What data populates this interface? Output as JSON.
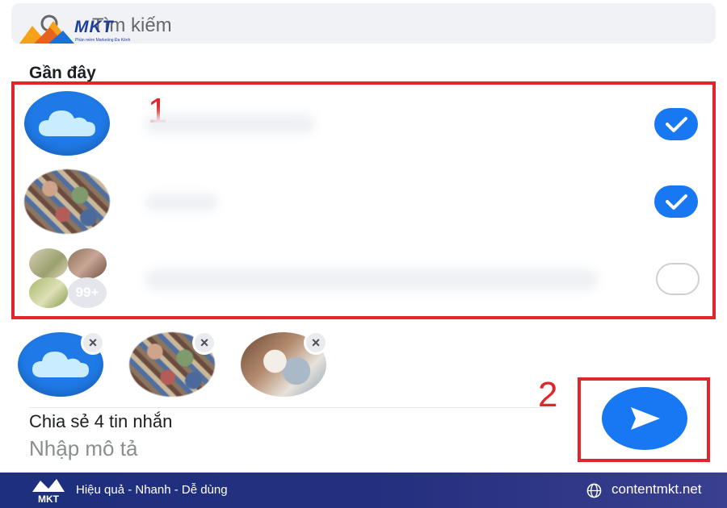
{
  "search": {
    "placeholder": "Tìm kiếm"
  },
  "logo": {
    "name": "MKT",
    "tagline": "Phần mềm Marketing Đa Kênh"
  },
  "recent": {
    "title": "Gần đây",
    "rows": [
      {
        "avatar": "cloud-icon",
        "selected": true
      },
      {
        "avatar": "group-photo",
        "selected": true
      },
      {
        "avatar": "group-collage",
        "more_badge": "99+",
        "selected": false
      }
    ]
  },
  "annotations": {
    "step1": "1",
    "step2": "2"
  },
  "selected_chips": [
    {
      "avatar": "cloud-icon",
      "remove": "×"
    },
    {
      "avatar": "group-photo",
      "remove": "×"
    },
    {
      "avatar": "food-photo",
      "remove": "×"
    }
  ],
  "share": {
    "title": "Chia sẻ 4 tin nhắn",
    "description_placeholder": "Nhập mô tả"
  },
  "footer": {
    "slogan": "Hiệu quả - Nhanh - Dễ dùng",
    "website": "contentmkt.net"
  },
  "colors": {
    "accent": "#1877f2",
    "annotation_red": "#e0262b",
    "footer_bg": "#1d2f7e"
  }
}
